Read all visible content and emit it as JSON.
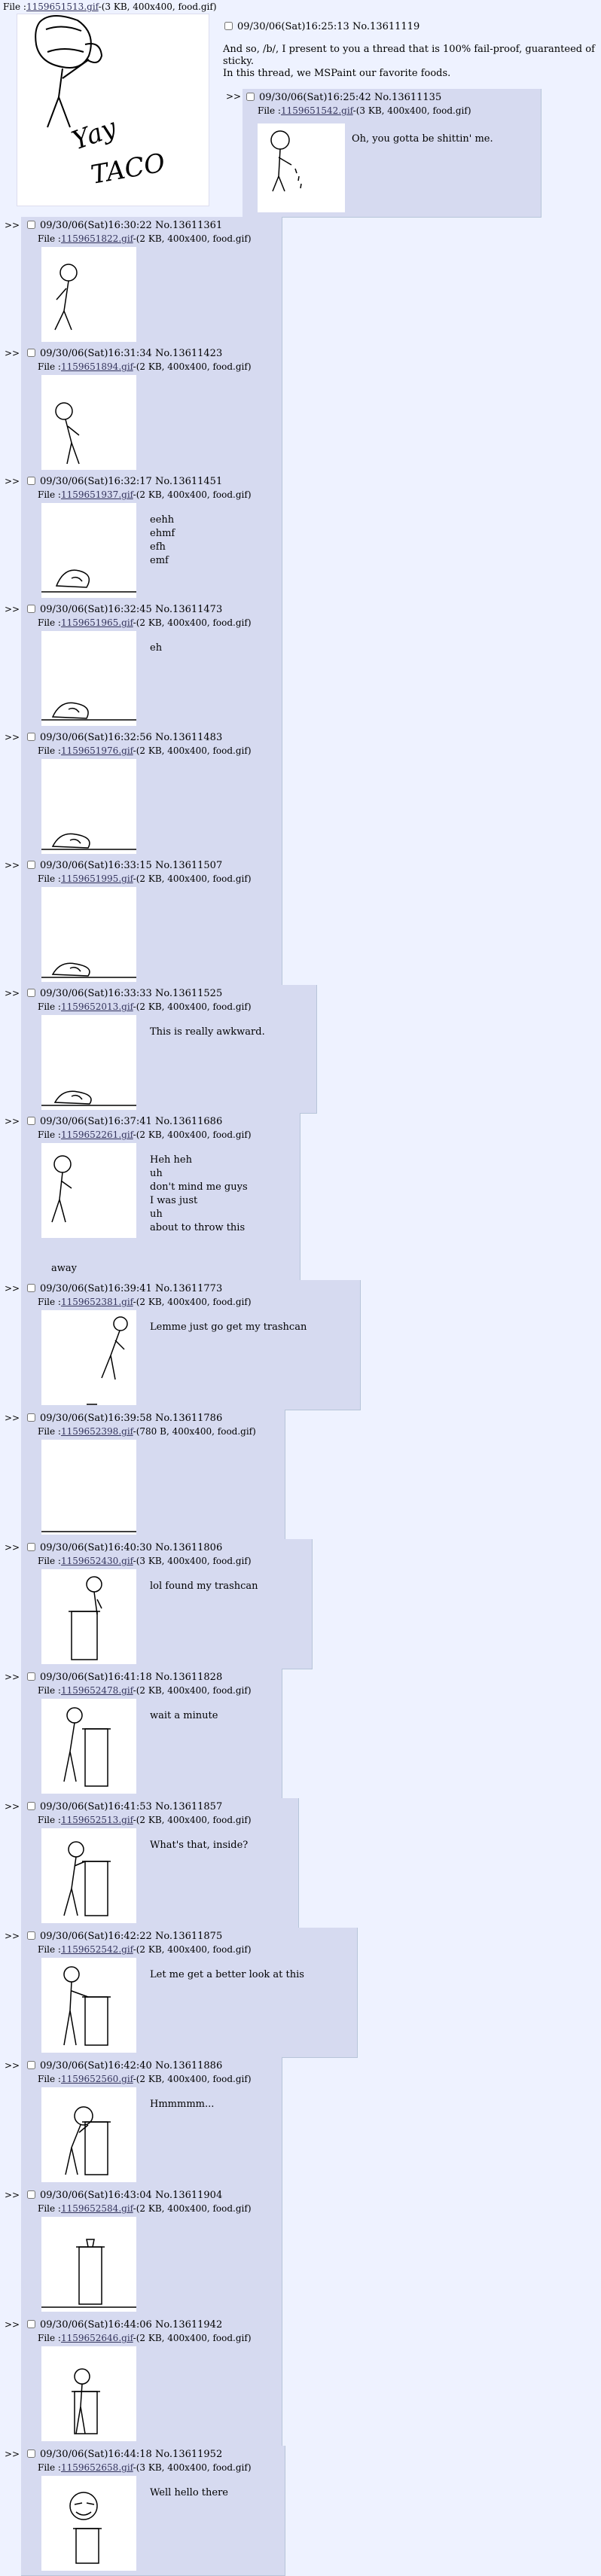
{
  "op": {
    "file_prefix": "File :",
    "file_name": "1159651513.gif",
    "file_meta": "-(3 KB, 400x400, food.gif)",
    "date": "09/30/06(Sat)16:25:13",
    "post_no": "No.13611119",
    "comment_line1": "And so, /b/, I present to you a thread that is 100% fail-proof, guaranteed of sticky.",
    "comment_line2": "In this thread, we MSPaint our favorite foods.",
    "image_text_yay": "Yay",
    "image_text_taco": "TACO"
  },
  "arrow": ">>",
  "file_prefix": "File :",
  "replies": [
    {
      "date": "09/30/06(Sat)16:25:42",
      "no": "No.13611135",
      "file": "1159651542.gif",
      "meta": "-(3 KB, 400x400, food.gif)",
      "comment": "Oh, you gotta be shittin' me."
    },
    {
      "date": "09/30/06(Sat)16:30:22",
      "no": "No.13611361",
      "file": "1159651822.gif",
      "meta": "-(2 KB, 400x400, food.gif)",
      "comment": ""
    },
    {
      "date": "09/30/06(Sat)16:31:34",
      "no": "No.13611423",
      "file": "1159651894.gif",
      "meta": "-(2 KB, 400x400, food.gif)",
      "comment": ""
    },
    {
      "date": "09/30/06(Sat)16:32:17",
      "no": "No.13611451",
      "file": "1159651937.gif",
      "meta": "-(2 KB, 400x400, food.gif)",
      "comment": "eehh\nehmf\nefh\nemf"
    },
    {
      "date": "09/30/06(Sat)16:32:45",
      "no": "No.13611473",
      "file": "1159651965.gif",
      "meta": "-(2 KB, 400x400, food.gif)",
      "comment": "eh"
    },
    {
      "date": "09/30/06(Sat)16:32:56",
      "no": "No.13611483",
      "file": "1159651976.gif",
      "meta": "-(2 KB, 400x400, food.gif)",
      "comment": ""
    },
    {
      "date": "09/30/06(Sat)16:33:15",
      "no": "No.13611507",
      "file": "1159651995.gif",
      "meta": "-(2 KB, 400x400, food.gif)",
      "comment": ""
    },
    {
      "date": "09/30/06(Sat)16:33:33",
      "no": "No.13611525",
      "file": "1159652013.gif",
      "meta": "-(2 KB, 400x400, food.gif)",
      "comment": "This is really awkward."
    },
    {
      "date": "09/30/06(Sat)16:37:41",
      "no": "No.13611686",
      "file": "1159652261.gif",
      "meta": "-(2 KB, 400x400, food.gif)",
      "comment": "Heh heh\nuh\ndon't mind me guys\nI was just\nuh\nabout to throw this",
      "comment_tail": "away"
    },
    {
      "date": "09/30/06(Sat)16:39:41",
      "no": "No.13611773",
      "file": "1159652381.gif",
      "meta": "-(2 KB, 400x400, food.gif)",
      "comment": "Lemme just go get my trashcan"
    },
    {
      "date": "09/30/06(Sat)16:39:58",
      "no": "No.13611786",
      "file": "1159652398.gif",
      "meta": "-(780 B, 400x400, food.gif)",
      "comment": ""
    },
    {
      "date": "09/30/06(Sat)16:40:30",
      "no": "No.13611806",
      "file": "1159652430.gif",
      "meta": "-(3 KB, 400x400, food.gif)",
      "comment": "lol found my trashcan"
    },
    {
      "date": "09/30/06(Sat)16:41:18",
      "no": "No.13611828",
      "file": "1159652478.gif",
      "meta": "-(2 KB, 400x400, food.gif)",
      "comment": "wait a minute"
    },
    {
      "date": "09/30/06(Sat)16:41:53",
      "no": "No.13611857",
      "file": "1159652513.gif",
      "meta": "-(2 KB, 400x400, food.gif)",
      "comment": "What's that, inside?"
    },
    {
      "date": "09/30/06(Sat)16:42:22",
      "no": "No.13611875",
      "file": "1159652542.gif",
      "meta": "-(2 KB, 400x400, food.gif)",
      "comment": "Let me get a better look at this"
    },
    {
      "date": "09/30/06(Sat)16:42:40",
      "no": "No.13611886",
      "file": "1159652560.gif",
      "meta": "-(2 KB, 400x400, food.gif)",
      "comment": "Hmmmmm..."
    },
    {
      "date": "09/30/06(Sat)16:43:04",
      "no": "No.13611904",
      "file": "1159652584.gif",
      "meta": "-(2 KB, 400x400, food.gif)",
      "comment": ""
    },
    {
      "date": "09/30/06(Sat)16:44:06",
      "no": "No.13611942",
      "file": "1159652646.gif",
      "meta": "-(2 KB, 400x400, food.gif)",
      "comment": ""
    },
    {
      "date": "09/30/06(Sat)16:44:18",
      "no": "No.13611952",
      "file": "1159652658.gif",
      "meta": "-(3 KB, 400x400, food.gif)",
      "comment": "Well hello there"
    }
  ]
}
